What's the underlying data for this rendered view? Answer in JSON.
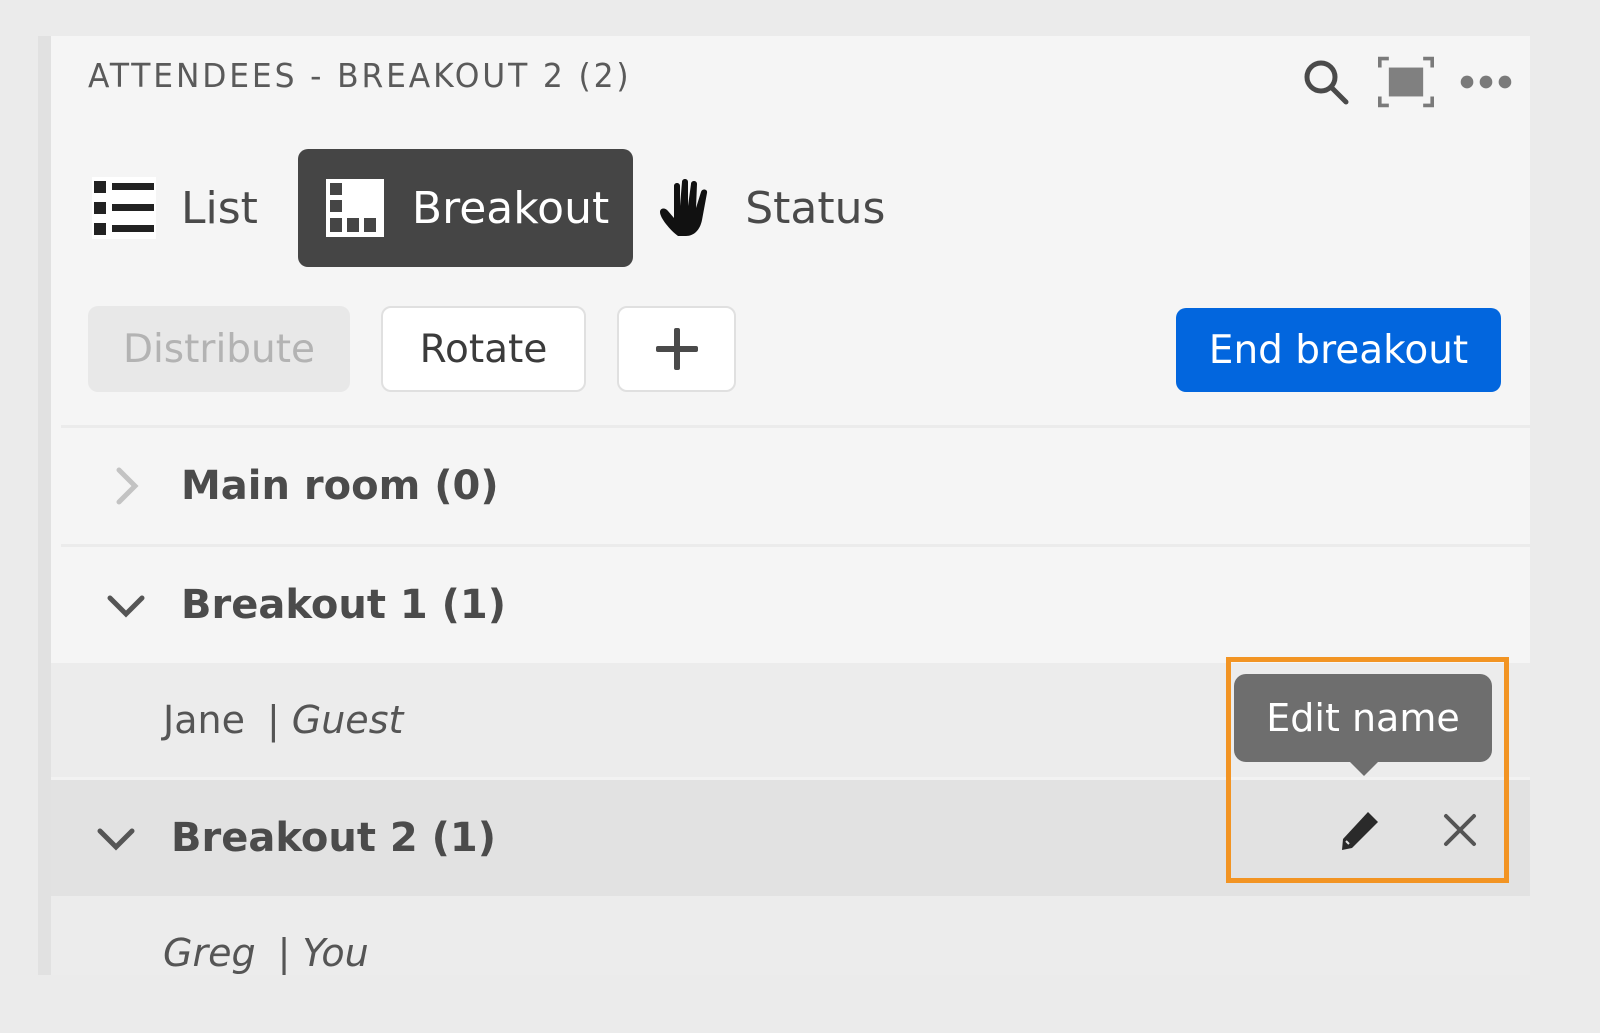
{
  "header": {
    "title": "ATTENDEES - BREAKOUT 2 (2)",
    "icons": [
      "search-icon",
      "fullscreen-icon",
      "more-options-icon"
    ]
  },
  "tabs": [
    {
      "label": "List",
      "icon": "list-icon",
      "active": false
    },
    {
      "label": "Breakout",
      "icon": "breakout-grid-icon",
      "active": true
    },
    {
      "label": "Status",
      "icon": "raised-hand-icon",
      "active": false
    }
  ],
  "actions": {
    "distribute_label": "Distribute",
    "distribute_disabled": true,
    "rotate_label": "Rotate",
    "add_label": "+",
    "end_label": "End breakout",
    "end_color": "#0266de"
  },
  "rooms": [
    {
      "name": "Main room (0)",
      "expanded": false,
      "attendees": []
    },
    {
      "name": "Breakout 1 (1)",
      "expanded": true,
      "attendees": [
        {
          "name": "Jane",
          "separator": "|",
          "role": "Guest"
        }
      ]
    },
    {
      "name": "Breakout 2 (1)",
      "expanded": true,
      "attendees": [
        {
          "name": "Greg",
          "separator": "|",
          "role": "You"
        }
      ]
    }
  ],
  "tooltip": {
    "text": "Edit name"
  },
  "row_actions": [
    "pencil-icon",
    "close-icon"
  ],
  "highlight_color": "#f29423"
}
